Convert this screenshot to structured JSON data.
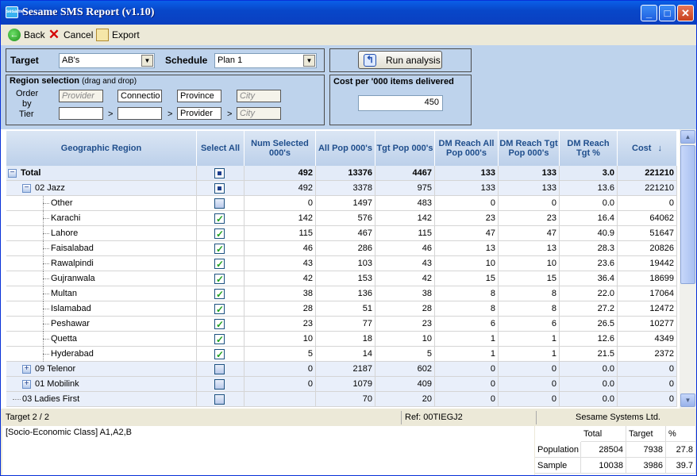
{
  "window": {
    "title": "Sesame SMS Report  (v1.10)",
    "icon_label": "sesame"
  },
  "toolbar": {
    "back_label": "Back",
    "cancel_label": "Cancel",
    "export_label": "Export"
  },
  "target": {
    "label": "Target",
    "value": "AB's"
  },
  "schedule": {
    "label": "Schedule",
    "value": "Plan 1"
  },
  "run_button": "Run analysis",
  "region_selection": {
    "title": "Region selection",
    "hint": "(drag and drop)",
    "order_label": "Order",
    "by_label": "by",
    "tier_label": "Tier",
    "order_boxes": [
      "Provider",
      "Connectio",
      "Province",
      "City"
    ],
    "tier_boxes": [
      "",
      "",
      "Provider",
      "City"
    ]
  },
  "cost": {
    "title": "Cost per '000 items delivered",
    "value": "450"
  },
  "grid": {
    "columns": [
      "Geographic Region",
      "Select All",
      "Num Selected 000's",
      "All Pop 000's",
      "Tgt Pop 000's",
      "DM Reach All Pop 000's",
      "DM Reach Tgt Pop 000's",
      "DM Reach Tgt %",
      "Cost"
    ],
    "sort_icon": "sort-desc-icon",
    "rows": [
      {
        "name": "Total",
        "level": 0,
        "expander": "−",
        "check": "ind",
        "bold": true,
        "vals": [
          "492",
          "13376",
          "4467",
          "133",
          "133",
          "3.0",
          "221210"
        ]
      },
      {
        "name": "02 Jazz",
        "level": 1,
        "expander": "−",
        "check": "ind",
        "vals": [
          "492",
          "3378",
          "975",
          "133",
          "133",
          "13.6",
          "221210"
        ]
      },
      {
        "name": "Other",
        "level": 2,
        "check": "off",
        "vals": [
          "0",
          "1497",
          "483",
          "0",
          "0",
          "0.0",
          "0"
        ]
      },
      {
        "name": "Karachi",
        "level": 2,
        "check": "on",
        "vals": [
          "142",
          "576",
          "142",
          "23",
          "23",
          "16.4",
          "64062"
        ]
      },
      {
        "name": "Lahore",
        "level": 2,
        "check": "on",
        "vals": [
          "115",
          "467",
          "115",
          "47",
          "47",
          "40.9",
          "51647"
        ]
      },
      {
        "name": "Faisalabad",
        "level": 2,
        "check": "on",
        "vals": [
          "46",
          "286",
          "46",
          "13",
          "13",
          "28.3",
          "20826"
        ]
      },
      {
        "name": "Rawalpindi",
        "level": 2,
        "check": "on",
        "vals": [
          "43",
          "103",
          "43",
          "10",
          "10",
          "23.6",
          "19442"
        ]
      },
      {
        "name": "Gujranwala",
        "level": 2,
        "check": "on",
        "vals": [
          "42",
          "153",
          "42",
          "15",
          "15",
          "36.4",
          "18699"
        ]
      },
      {
        "name": "Multan",
        "level": 2,
        "check": "on",
        "vals": [
          "38",
          "136",
          "38",
          "8",
          "8",
          "22.0",
          "17064"
        ]
      },
      {
        "name": "Islamabad",
        "level": 2,
        "check": "on",
        "vals": [
          "28",
          "51",
          "28",
          "8",
          "8",
          "27.2",
          "12472"
        ]
      },
      {
        "name": "Peshawar",
        "level": 2,
        "check": "on",
        "vals": [
          "23",
          "77",
          "23",
          "6",
          "6",
          "26.5",
          "10277"
        ]
      },
      {
        "name": "Quetta",
        "level": 2,
        "check": "on",
        "vals": [
          "10",
          "18",
          "10",
          "1",
          "1",
          "12.6",
          "4349"
        ]
      },
      {
        "name": "Hyderabad",
        "level": 2,
        "check": "on",
        "vals": [
          "5",
          "14",
          "5",
          "1",
          "1",
          "21.5",
          "2372"
        ]
      },
      {
        "name": "09 Telenor",
        "level": 1,
        "expander": "+",
        "check": "off",
        "vals": [
          "0",
          "2187",
          "602",
          "0",
          "0",
          "0.0",
          "0"
        ]
      },
      {
        "name": "01 Mobilink",
        "level": 1,
        "expander": "+",
        "check": "off",
        "vals": [
          "0",
          "1079",
          "409",
          "0",
          "0",
          "0.0",
          "0"
        ]
      },
      {
        "name": "03 Ladies First",
        "level": 1,
        "check": "off",
        "vals": [
          "",
          "70",
          "20",
          "0",
          "0",
          "0.0",
          "0"
        ]
      }
    ]
  },
  "status": {
    "target_count": "Target 2 / 2",
    "ref": "Ref: 00TIEGJ2",
    "company": "Sesame Systems Ltd."
  },
  "criteria": "[Socio-Economic Class] A1,A2,B",
  "summary": {
    "headers": [
      "Total",
      "Target",
      "%"
    ],
    "rows": [
      {
        "label": "Population",
        "vals": [
          "28504",
          "7938",
          "27.8"
        ]
      },
      {
        "label": "Sample",
        "vals": [
          "10038",
          "3986",
          "39.7"
        ]
      }
    ]
  }
}
